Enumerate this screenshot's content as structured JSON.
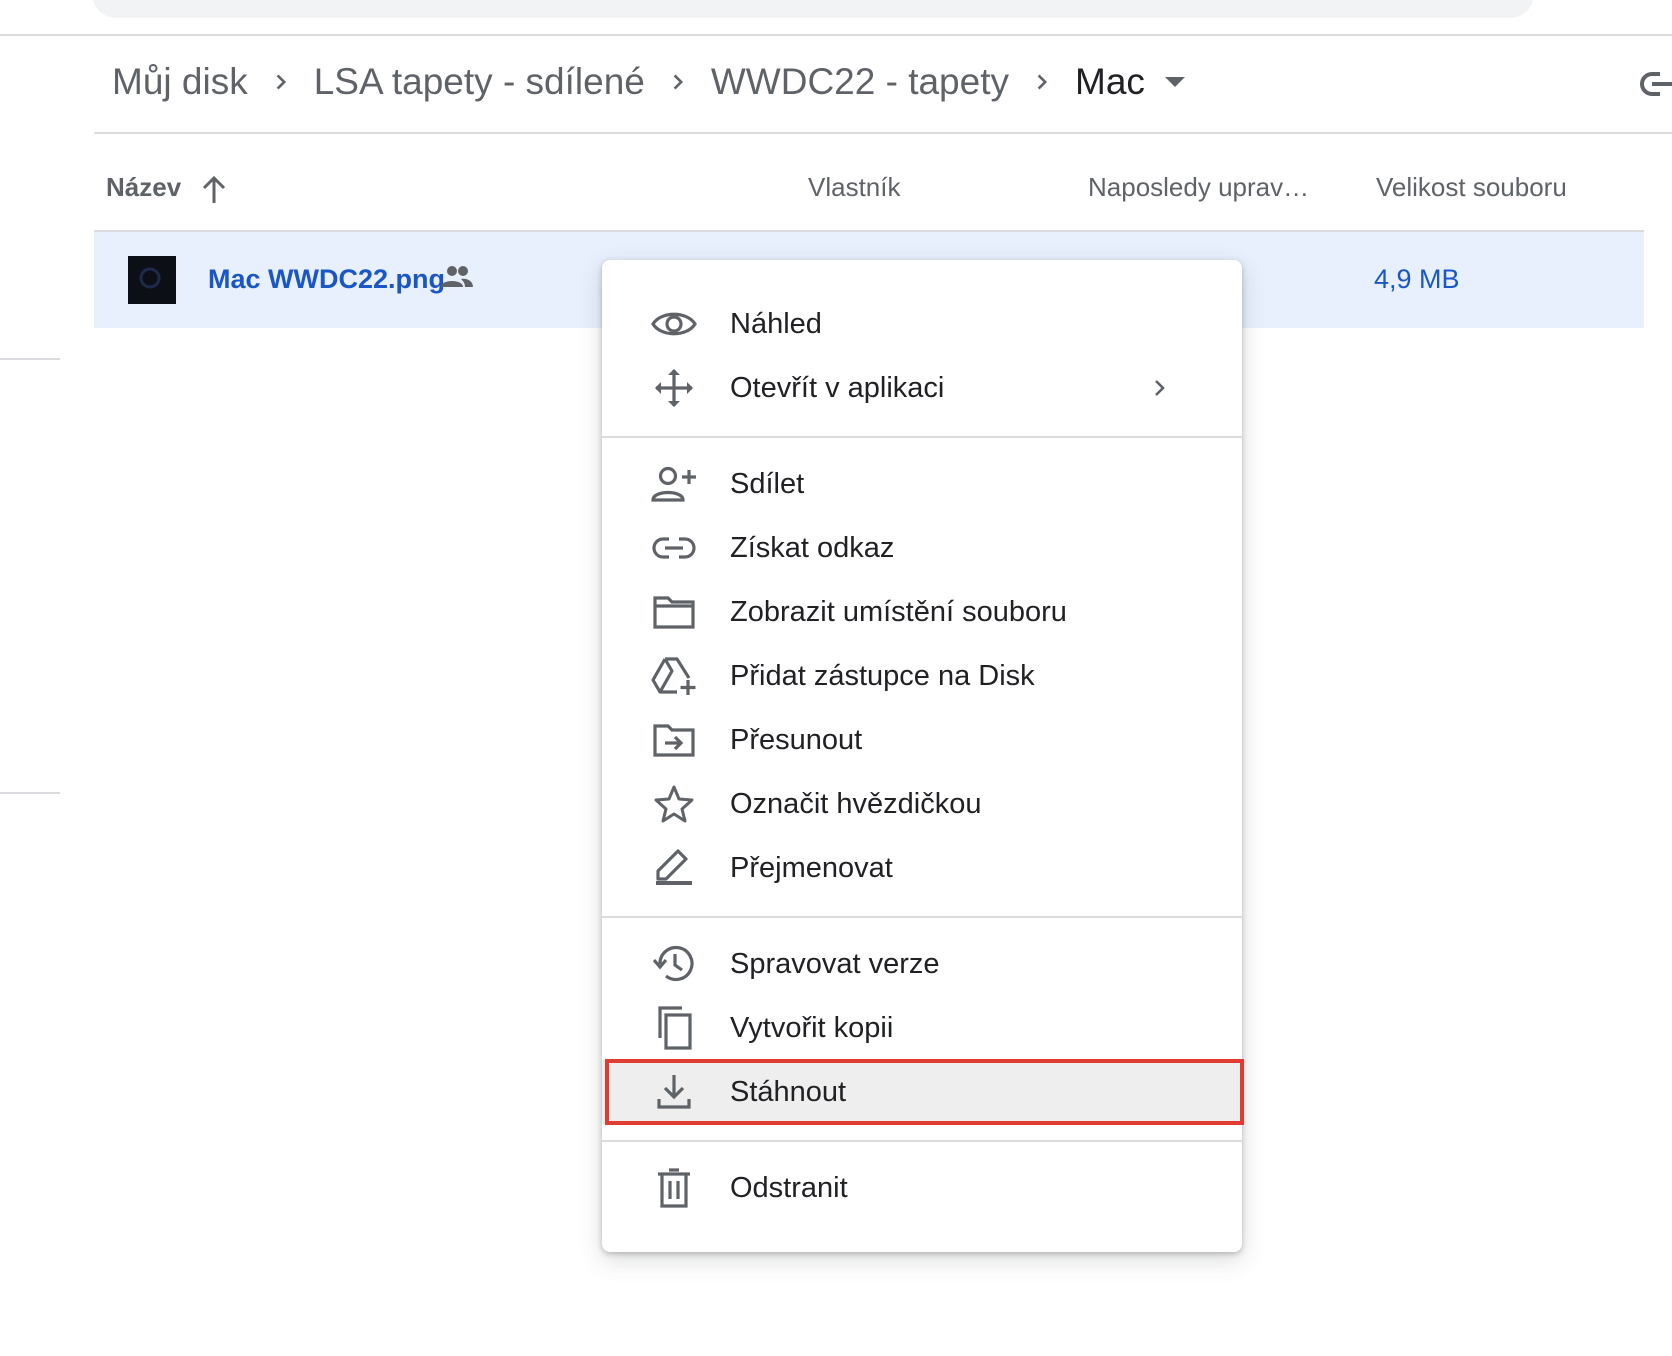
{
  "breadcrumb": {
    "items": [
      "Můj disk",
      "LSA tapety - sdílené",
      "WWDC22 - tapety",
      "Mac"
    ]
  },
  "table": {
    "columns": {
      "name": "Název",
      "owner": "Vlastník",
      "modified": "Naposledy uprav…",
      "size": "Velikost souboru"
    },
    "rows": [
      {
        "name": "Mac WWDC22.png",
        "size": "4,9 MB",
        "shared": true
      }
    ]
  },
  "context_menu": {
    "items": [
      {
        "label": "Náhled",
        "icon": "eye-icon"
      },
      {
        "label": "Otevřít v aplikaci",
        "icon": "open-with-icon",
        "submenu": true
      },
      {
        "label": "Sdílet",
        "icon": "person-add-icon"
      },
      {
        "label": "Získat odkaz",
        "icon": "link-icon"
      },
      {
        "label": "Zobrazit umístění souboru",
        "icon": "folder-icon"
      },
      {
        "label": "Přidat zástupce na Disk",
        "icon": "drive-shortcut-icon"
      },
      {
        "label": "Přesunout",
        "icon": "move-folder-icon"
      },
      {
        "label": "Označit hvězdičkou",
        "icon": "star-icon"
      },
      {
        "label": "Přejmenovat",
        "icon": "pencil-icon"
      },
      {
        "label": "Spravovat verze",
        "icon": "history-icon"
      },
      {
        "label": "Vytvořit kopii",
        "icon": "copy-icon"
      },
      {
        "label": "Stáhnout",
        "icon": "download-icon",
        "highlighted": true
      },
      {
        "label": "Odstranit",
        "icon": "trash-icon"
      }
    ]
  },
  "colors": {
    "selection_bg": "#e8f0fe",
    "link_blue": "#1a56c4",
    "highlight_border": "#e03c31"
  }
}
